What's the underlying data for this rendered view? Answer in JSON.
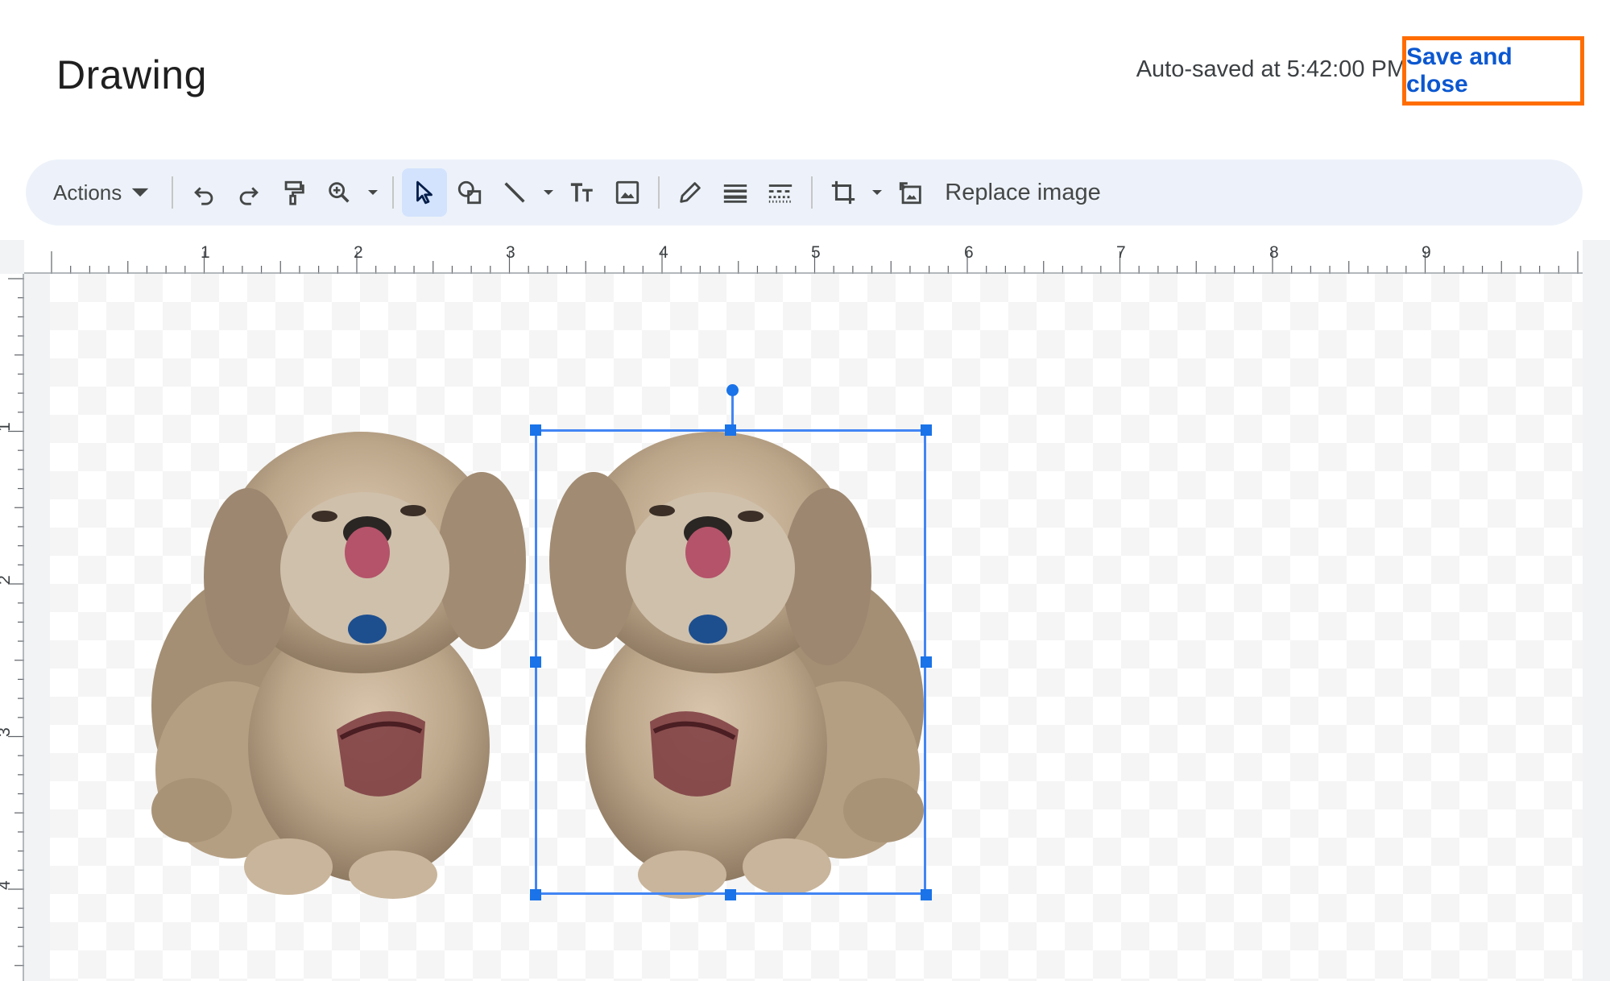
{
  "header": {
    "title": "Drawing",
    "autosave_text": "Auto-saved at 5:42:00 PM",
    "save_close_label": "Save and close",
    "highlight_color": "#ff6d00"
  },
  "toolbar": {
    "actions_label": "Actions",
    "replace_image_label": "Replace image",
    "icons": [
      "undo-icon",
      "redo-icon",
      "paint-format-icon",
      "zoom-icon",
      "select-icon",
      "shape-icon",
      "line-icon",
      "text-box-icon",
      "image-icon",
      "pen-icon",
      "line-weight-icon",
      "line-dash-icon",
      "crop-icon",
      "reset-image-icon"
    ],
    "active_tool": "select"
  },
  "rulers": {
    "horizontal": [
      "1",
      "2",
      "3",
      "4",
      "5",
      "6",
      "7",
      "8",
      "9"
    ],
    "vertical": [
      "1",
      "2",
      "3",
      "4"
    ]
  },
  "canvas": {
    "objects": [
      {
        "name": "dog-image-left",
        "selected": false
      },
      {
        "name": "dog-image-right-flipped",
        "selected": true
      }
    ],
    "selection_color": "#1a73e8"
  }
}
